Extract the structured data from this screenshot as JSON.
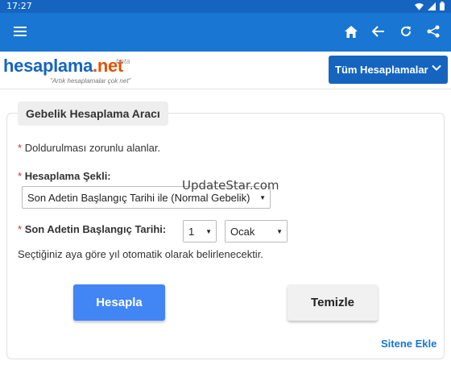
{
  "status_bar": {
    "time": "17:27",
    "icons": [
      "wifi-icon",
      "signal-icon",
      "battery-icon"
    ]
  },
  "app_bar": {
    "actions": [
      "menu-icon",
      "home-icon",
      "back-arrow-icon",
      "refresh-icon",
      "share-icon"
    ]
  },
  "site": {
    "logo_main": "hesaplama",
    "logo_suffix": ".net",
    "logo_beta": "beta",
    "tagline": "\"Artık hesaplamalar çok net\"",
    "all_calculations_label": "Tüm Hesaplamalar"
  },
  "form": {
    "title": "Gebelik Hesaplama Aracı",
    "required_star": "*",
    "required_note": "Doldurulması zorunlu alanlar.",
    "method_label": "Hesaplama Şekli:",
    "method_value": "Son Adetin Başlangıç Tarihi ile (Normal Gebelik)",
    "date_label": "Son Adetin Başlangıç Tarihi:",
    "day_value": "1",
    "month_value": "Ocak",
    "info_text": "Seçtiğiniz aya göre yıl otomatik olarak belirlenecektir.",
    "calculate_label": "Hesapla",
    "clear_label": "Temizle",
    "add_site_label": "Sitene Ekle"
  },
  "watermark": "UpdateStar.com",
  "colors": {
    "app_bar": "#1976d2",
    "status_bar": "#1565c0",
    "primary_button": "#4285f4",
    "required": "#d32f2f",
    "logo_accent": "#e65100"
  }
}
